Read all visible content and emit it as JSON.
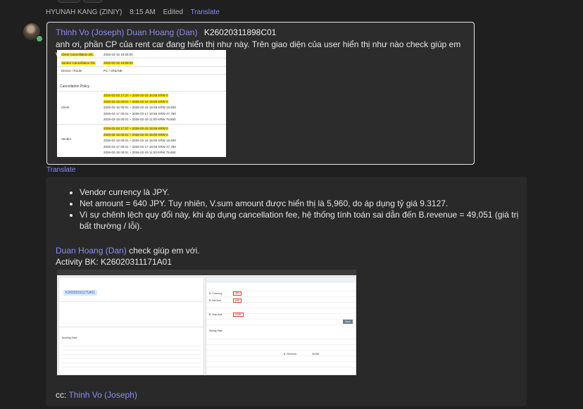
{
  "header": {
    "author": "HYUNAH KANG (ZINIY)",
    "time": "8:15 AM",
    "edited": "Edited",
    "translate": "Translate"
  },
  "quote": {
    "mention1": "Thinh Vo (Joseph)",
    "mention2": "Duan Hoang (Dan)",
    "booking_code": "K26020311898C01",
    "text": "anh ơi, phần CP của rent car đang hiển thị như này. Trên giao diện của user hiển thị như nào check giúp em với.",
    "screenshot": {
      "client_cancel_dl_label": "Client Cancellation D/L",
      "client_cancel_dl_value": "2026-02-15 16:59:00",
      "vendor_cancel_dl_label": "Vendor Cancellation D/L",
      "vendor_cancel_dl_value": "2026-02-15 16:59:00",
      "device_route_label": "Device / Route",
      "device_route_value": "PC / ONLINE",
      "policy_title": "Cancellation Policy",
      "client_label": "Client",
      "vendor_label": "Vendor",
      "client_rows": [
        "2026-02-03 17:37 ~ 2026-02-15 16:59  KRW 0",
        "2026-02-16 00:01 ~ 2026-02-16 16:59  KRW 0",
        "2026-02-16 00:01 ~ 2026-02-16 16:59  KRW 15,830",
        "2026-02-17 00:01 ~ 2026-02-17 16:59  KRW 47,780",
        "2026-02-18 00:01 ~ 2026-02-19 11:00  KRW 79,650"
      ],
      "vendor_rows": [
        "2026-02-03 17:37 ~ 2026-02-15 16:59  KRW 0",
        "2026-02-16 00:01 ~ 2026-02-16 16:59  KRW 0",
        "2026-02-16 00:01 ~ 2026-02-16 16:59  KRW 15,830",
        "2026-02-17 00:01 ~ 2026-02-17 16:59  KRW 47,780",
        "2026-02-18 00:01 ~ 2026-02-19 11:00  KRW 79,650"
      ]
    }
  },
  "translate2": "Translate",
  "message": {
    "bullets": [
      "Vendor currency là JPY.",
      "Net amount = 640 JPY. Tuy nhiên, V.sum amount được hiển thị là 5,960, do áp dụng tỷ giá 9.3127.",
      "Vì sự chênh lệch quy đổi này, khi áp dụng cancellation fee, hệ thống tính toán sai dẫn đến B.revenue = 49,051 (giá trị bất thường / lỗi)."
    ],
    "mention": "Duan Hoang (Dan)",
    "mention_suffix": " check giúp em với.",
    "activity": "Activity BK: K26020311171A01",
    "cc_label": "cc: ",
    "cc_mention": "Thinh Vo (Joseph)",
    "screenshot2": {
      "booking_id": "K26020311171A01",
      "booking_data_title": "Booking Data",
      "selling_rate_title": "Selling Rate",
      "currency_label": "B. Currency",
      "currency_value": "JPY",
      "net_amt_label": "B. Net Amt",
      "net_amt_value": "640",
      "sum_amt_label": "B. Sum Amt",
      "sum_amt_value": "5,960",
      "revenue_label": "B. Revenue",
      "revenue_value": "49,051",
      "save_label": "Save"
    }
  }
}
